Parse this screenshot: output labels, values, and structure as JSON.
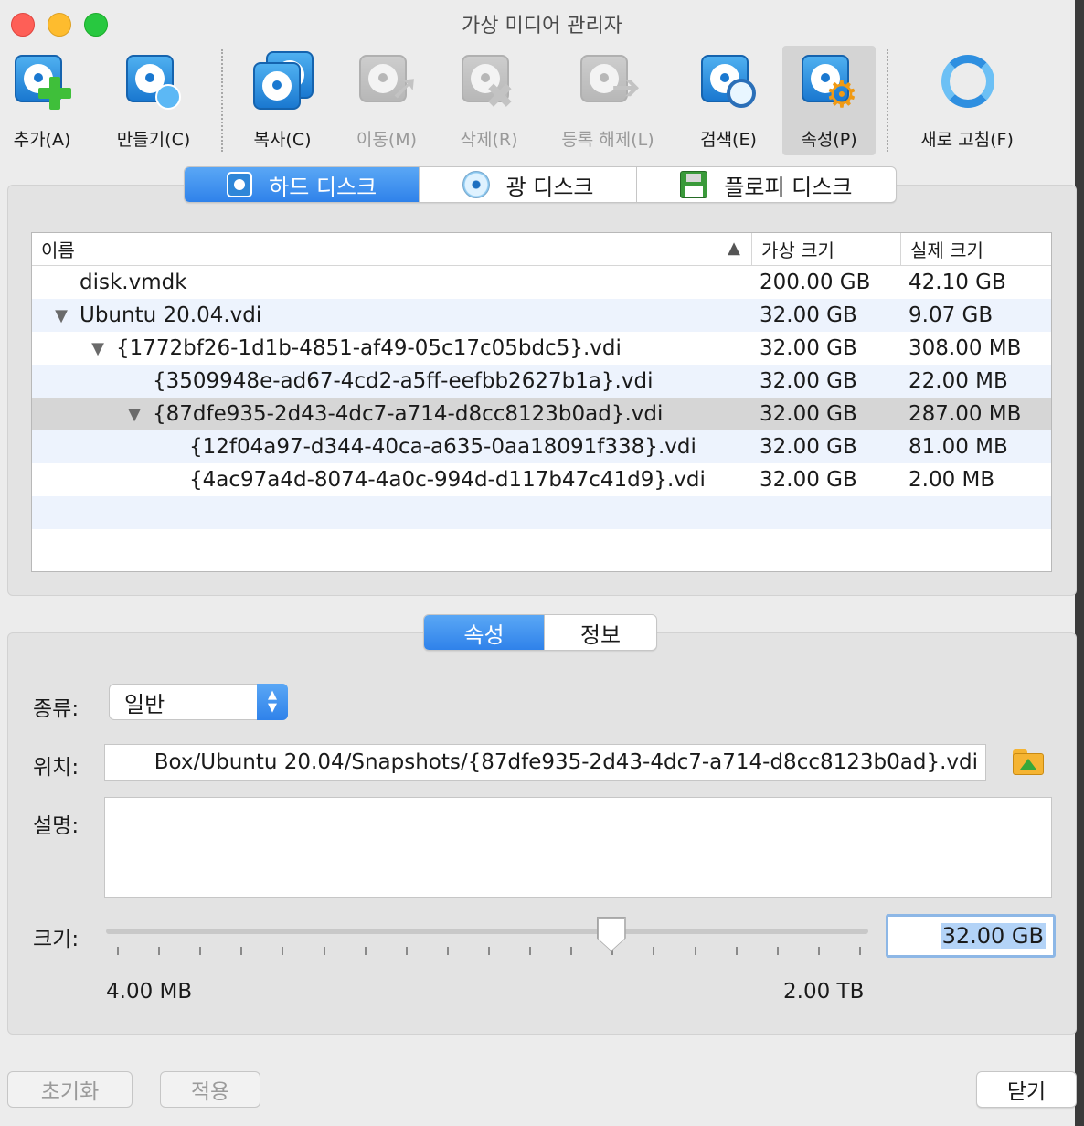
{
  "window": {
    "title": "가상 미디어 관리자"
  },
  "toolbar": {
    "add": "추가(A)",
    "create": "만들기(C)",
    "copy": "복사(C)",
    "move": "이동(M)",
    "remove": "삭제(R)",
    "release": "등록 해제(L)",
    "search": "검색(E)",
    "properties": "속성(P)",
    "refresh": "새로 고침(F)"
  },
  "media_tabs": {
    "hard": "하드 디스크",
    "optical": "광 디스크",
    "floppy": "플로피 디스크",
    "selected": "hard"
  },
  "table": {
    "headers": {
      "name": "이름",
      "virtual": "가상 크기",
      "actual": "실제 크기"
    },
    "rows": [
      {
        "name": "disk.vmdk",
        "virtual": "200.00 GB",
        "actual": "42.10 GB",
        "depth": 0,
        "expanded": false,
        "has_children": false
      },
      {
        "name": "Ubuntu 20.04.vdi",
        "virtual": "32.00 GB",
        "actual": "9.07 GB",
        "depth": 0,
        "expanded": true,
        "has_children": true
      },
      {
        "name": "{1772bf26-1d1b-4851-af49-05c17c05bdc5}.vdi",
        "virtual": "32.00 GB",
        "actual": "308.00 MB",
        "depth": 1,
        "expanded": true,
        "has_children": true
      },
      {
        "name": "{3509948e-ad67-4cd2-a5ff-eefbb2627b1a}.vdi",
        "virtual": "32.00 GB",
        "actual": "22.00 MB",
        "depth": 2,
        "expanded": false,
        "has_children": false
      },
      {
        "name": "{87dfe935-2d43-4dc7-a714-d8cc8123b0ad}.vdi",
        "virtual": "32.00 GB",
        "actual": "287.00 MB",
        "depth": 2,
        "expanded": true,
        "has_children": true,
        "selected": true
      },
      {
        "name": "{12f04a97-d344-40ca-a635-0aa18091f338}.vdi",
        "virtual": "32.00 GB",
        "actual": "81.00 MB",
        "depth": 3,
        "expanded": false,
        "has_children": false
      },
      {
        "name": "{4ac97a4d-8074-4a0c-994d-d117b47c41d9}.vdi",
        "virtual": "32.00 GB",
        "actual": "2.00 MB",
        "depth": 3,
        "expanded": false,
        "has_children": false
      }
    ]
  },
  "detail_tabs": {
    "attributes": "속성",
    "info": "정보",
    "selected": "attributes"
  },
  "form": {
    "type_label": "종류:",
    "type_value": "일반",
    "location_label": "위치:",
    "location_value": "Box/Ubuntu 20.04/Snapshots/{87dfe935-2d43-4dc7-a714-d8cc8123b0ad}.vdi",
    "description_label": "설명:",
    "description_value": "",
    "size_label": "크기:",
    "size_value": "32.00 GB",
    "slider_min": "4.00 MB",
    "slider_max": "2.00 TB",
    "slider_fraction": 0.67
  },
  "buttons": {
    "reset": "초기화",
    "apply": "적용",
    "close": "닫기"
  }
}
